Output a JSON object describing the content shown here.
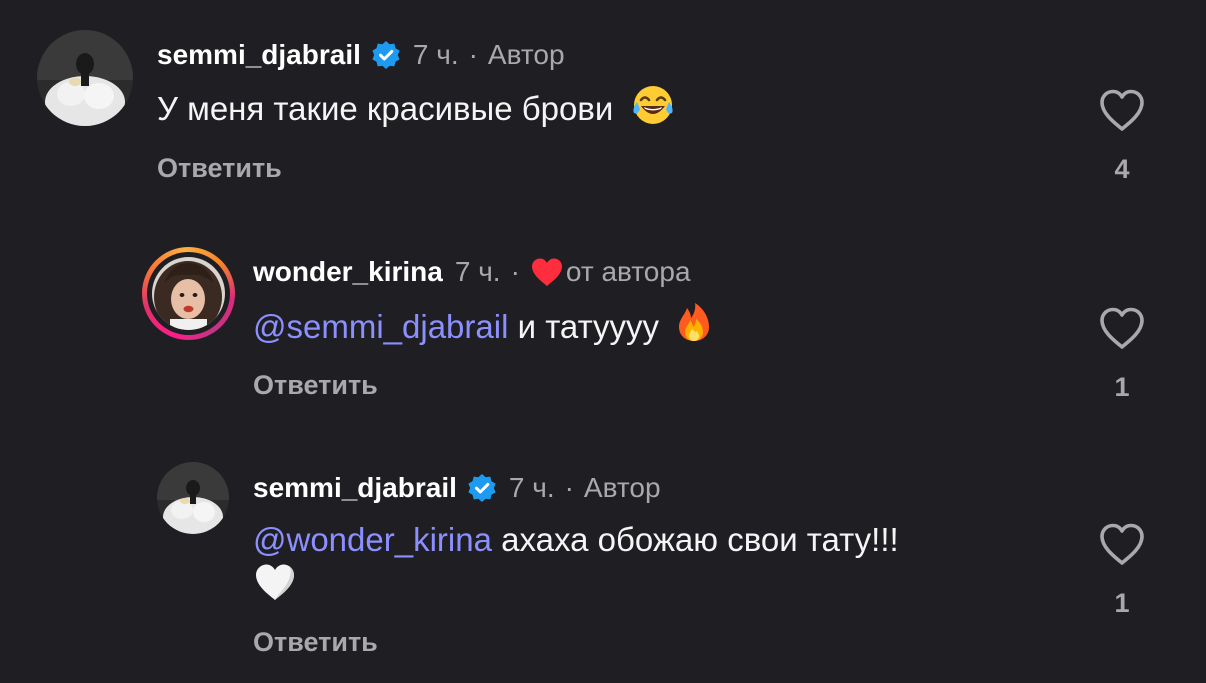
{
  "comments": [
    {
      "username": "semmi_djabrail",
      "verified_icon": "verified-badge-icon",
      "time": "7 ч.",
      "separator": "·",
      "tag": "Автор",
      "text": "У меня такие красивые брови",
      "emoji": "face-with-tears-of-joy-icon",
      "reply_label": "Ответить",
      "like_count": "4"
    },
    {
      "username": "wonder_kirina",
      "time": "7 ч.",
      "separator": "·",
      "liked_by_author_icon": "red-heart-icon",
      "tag": "от автора",
      "mention": "@semmi_djabrail",
      "text": " и татуууу",
      "emoji": "fire-icon",
      "reply_label": "Ответить",
      "like_count": "1"
    },
    {
      "username": "semmi_djabrail",
      "verified_icon": "verified-badge-icon",
      "time": "7 ч.",
      "separator": "·",
      "tag": "Автор",
      "mention": "@wonder_kirina",
      "text": " ахаха обожаю свои тату!!!",
      "emoji": "white-heart-icon",
      "reply_label": "Ответить",
      "like_count": "1"
    }
  ],
  "colors": {
    "background": "#1f1f23",
    "mention": "#8c90ff",
    "muted": "#a8a8ad",
    "verified": "#1d9bf0",
    "heart_red": "#ff2d3d"
  }
}
